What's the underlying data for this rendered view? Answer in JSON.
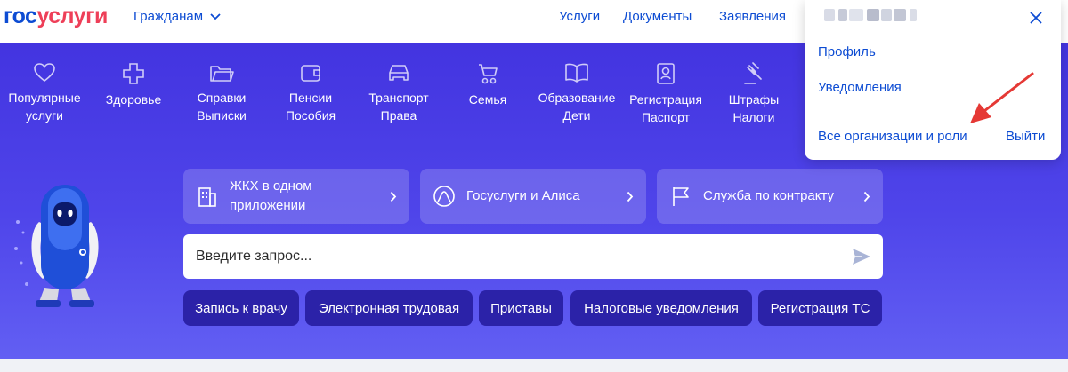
{
  "header": {
    "logo_part1": "гос",
    "logo_part2": "услуги",
    "audience_label": "Гражданам",
    "nav": [
      "Услуги",
      "Документы",
      "Заявления"
    ]
  },
  "categories": [
    {
      "line1": "Популярные",
      "line2": "услуги",
      "icon": "heart-icon"
    },
    {
      "line1": "Здоровье",
      "line2": "",
      "icon": "medical-cross-icon"
    },
    {
      "line1": "Справки",
      "line2": "Выписки",
      "icon": "folder-icon"
    },
    {
      "line1": "Пенсии",
      "line2": "Пособия",
      "icon": "wallet-icon"
    },
    {
      "line1": "Транспорт",
      "line2": "Права",
      "icon": "car-icon"
    },
    {
      "line1": "Семья",
      "line2": "",
      "icon": "stroller-icon"
    },
    {
      "line1": "Образование",
      "line2": "Дети",
      "icon": "book-icon"
    },
    {
      "line1": "Регистрация",
      "line2": "Паспорт",
      "icon": "passport-icon"
    },
    {
      "line1": "Штрафы",
      "line2": "Налоги",
      "icon": "gavel-icon"
    }
  ],
  "promos": [
    {
      "line1": "ЖКХ в одном",
      "line2": "приложении",
      "icon": "building-icon"
    },
    {
      "line1": "Госуслуги и Алиса",
      "line2": "",
      "icon": "alice-icon"
    },
    {
      "line1": "Служба по контракту",
      "line2": "",
      "icon": "flag-icon"
    }
  ],
  "search": {
    "placeholder": "Введите запрос..."
  },
  "quick_links": [
    "Запись к врачу",
    "Электронная трудовая",
    "Приставы",
    "Налоговые уведомления",
    "Регистрация ТС"
  ],
  "user_menu": {
    "profile": "Профиль",
    "notifications": "Уведомления",
    "organizations": "Все организации и роли",
    "logout": "Выйти"
  },
  "colors": {
    "brand_blue": "#0d4cd3",
    "brand_red": "#ee3f58",
    "hero": "#4b3fe6",
    "chip": "#2b22a8",
    "annotation_arrow": "#e53935"
  }
}
